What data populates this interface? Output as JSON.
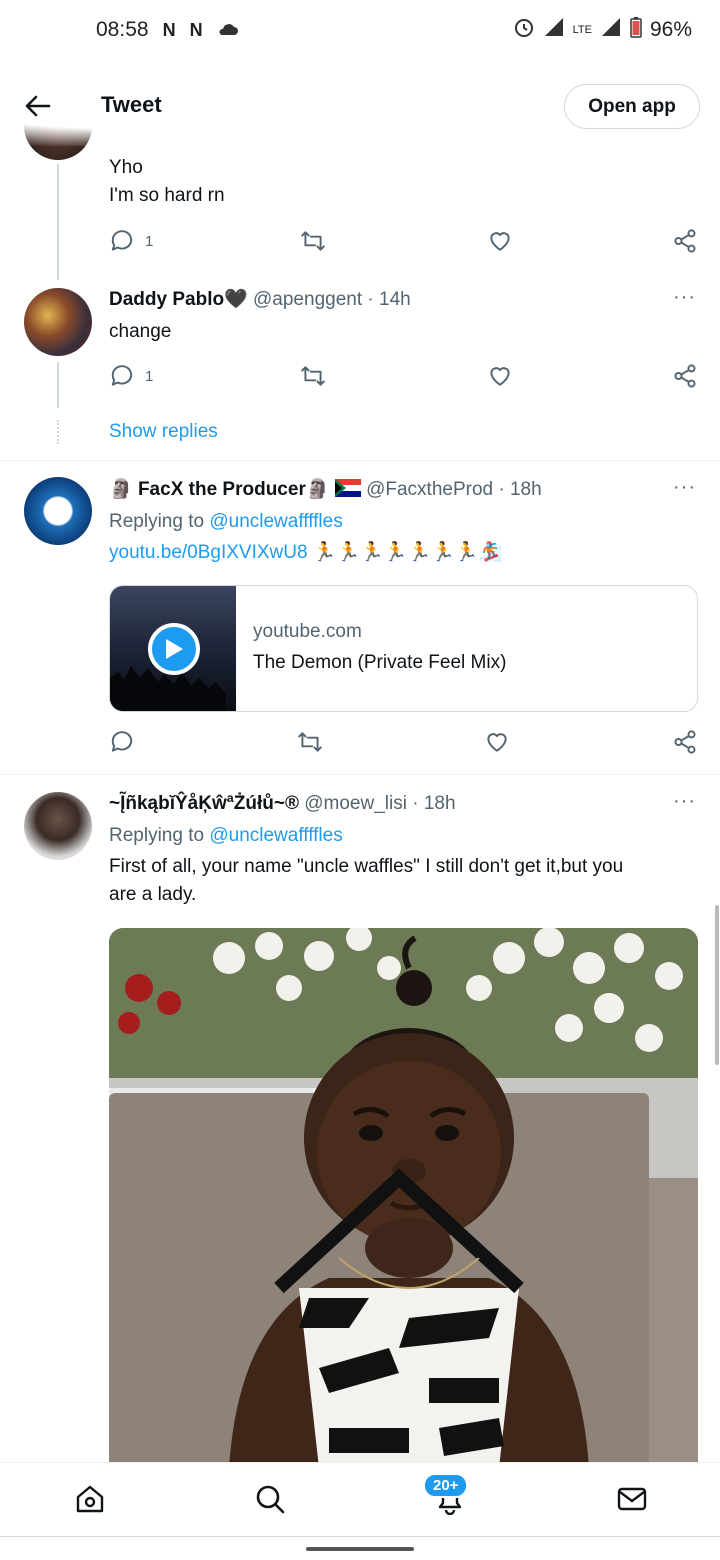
{
  "status_bar": {
    "time": "08:58",
    "net1": "N",
    "net2": "N",
    "lte": "LTE",
    "battery": "96%"
  },
  "header": {
    "title": "Tweet",
    "open_app": "Open app"
  },
  "tweets": [
    {
      "text_line1": "Yho",
      "text_line2": "I'm so hard rn",
      "reply_count": "1"
    },
    {
      "name": "Daddy Pablo🖤",
      "handle": "@apenggent",
      "time": "· 14h",
      "text": "change",
      "reply_count": "1"
    },
    {
      "show_replies": "Show replies"
    },
    {
      "name": "FacX the Producer",
      "handle": "@FacxtheProd",
      "time": "· 18h",
      "replying_prefix": "Replying to ",
      "replying_to": "@unclewaffffles",
      "link_text": "youtu.be/0BgIXVIXwU8",
      "emoji_tail": "🏃🏃🏃🏃🏃🏃🏃🏂",
      "card_domain": "youtube.com",
      "card_title": "The Demon (Private Feel Mix)"
    },
    {
      "name": "~Į̃ñkąbĭŶåĶŵªŻúłů~®",
      "handle": "@moew_lisi",
      "time": "· 18h",
      "replying_prefix": "Replying to ",
      "replying_to": "@unclewaffffles",
      "text_line1": "First of all, your name \"uncle waffles\" I still don't get it,but you",
      "text_line2": "are a lady."
    }
  ],
  "bottom_nav": {
    "badge": "20+"
  },
  "colors": {
    "accent": "#1d9bf0",
    "muted": "#536471",
    "border": "#cfd9de"
  },
  "icons": [
    "back-arrow-icon",
    "reply-icon",
    "retweet-icon",
    "like-icon",
    "share-icon",
    "more-icon",
    "home-icon",
    "search-icon",
    "notifications-icon",
    "messages-icon",
    "play-icon"
  ]
}
